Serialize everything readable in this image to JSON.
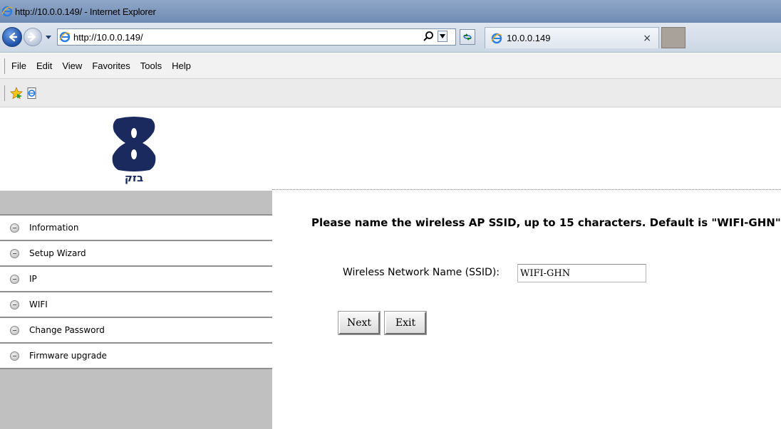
{
  "window": {
    "title": "http://10.0.0.149/ - Internet Explorer"
  },
  "browser": {
    "address": "http://10.0.0.149/",
    "tab_title": "10.0.0.149",
    "tab_close": "×",
    "menu": [
      "File",
      "Edit",
      "View",
      "Favorites",
      "Tools",
      "Help"
    ],
    "icons": {
      "back": "back-arrow-icon",
      "forward": "forward-arrow-icon",
      "search": "search-icon",
      "refresh": "refresh-icon",
      "favorites": "favorites-star-icon",
      "suggested_sites": "suggested-sites-icon"
    }
  },
  "page": {
    "logo_text": "בזק",
    "sidebar": {
      "items": [
        {
          "label": "Information"
        },
        {
          "label": "Setup Wizard"
        },
        {
          "label": "IP"
        },
        {
          "label": "WIFI"
        },
        {
          "label": "Change Password"
        },
        {
          "label": "Firmware upgrade"
        }
      ]
    },
    "instruction": "Please name the wireless AP SSID, up to 15 characters. Default is \"WIFI-GHN\"",
    "ssid_label": "Wireless Network Name (SSID):",
    "ssid_value": "WIFI-GHN",
    "next_label": "Next",
    "exit_label": "Exit"
  },
  "colors": {
    "title_bar": "#7f99bf",
    "sidebar_gray": "#c0c0c0",
    "logo_navy": "#1a2a5e"
  }
}
